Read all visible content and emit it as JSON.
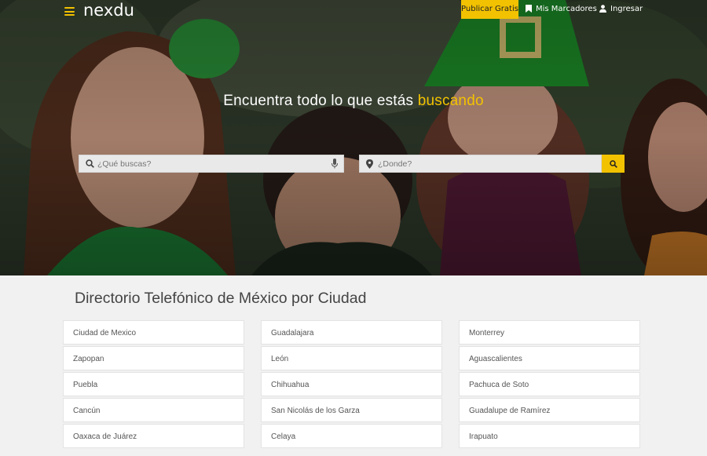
{
  "nav": {
    "logo": "nexdu",
    "publish_label": "Publicar Gratis",
    "bookmarks_label": "Mis Marcadores",
    "login_label": "Ingresar"
  },
  "hero": {
    "headline_prefix": "Encuentra todo lo que estás ",
    "headline_accent": "buscando"
  },
  "search": {
    "what_placeholder": "¿Qué buscas?",
    "where_placeholder": "¿Donde?"
  },
  "directory": {
    "title": "Directorio Telefónico de México por Ciudad",
    "columns": [
      [
        "Ciudad de Mexico",
        "Zapopan",
        "Puebla",
        "Cancún",
        "Oaxaca de Juárez"
      ],
      [
        "Guadalajara",
        "León",
        "Chihuahua",
        "San Nicolás de los Garza",
        "Celaya"
      ],
      [
        "Monterrey",
        "Aguascalientes",
        "Pachuca de Soto",
        "Guadalupe de Ramírez",
        "Irapuato"
      ]
    ]
  },
  "colors": {
    "accent": "#f2c200",
    "page_bg": "#f1f1f1",
    "text_dark": "#444444"
  },
  "icons": [
    "menu-icon",
    "bookmark-icon",
    "user-icon",
    "search-icon",
    "microphone-icon",
    "map-pin-icon"
  ]
}
